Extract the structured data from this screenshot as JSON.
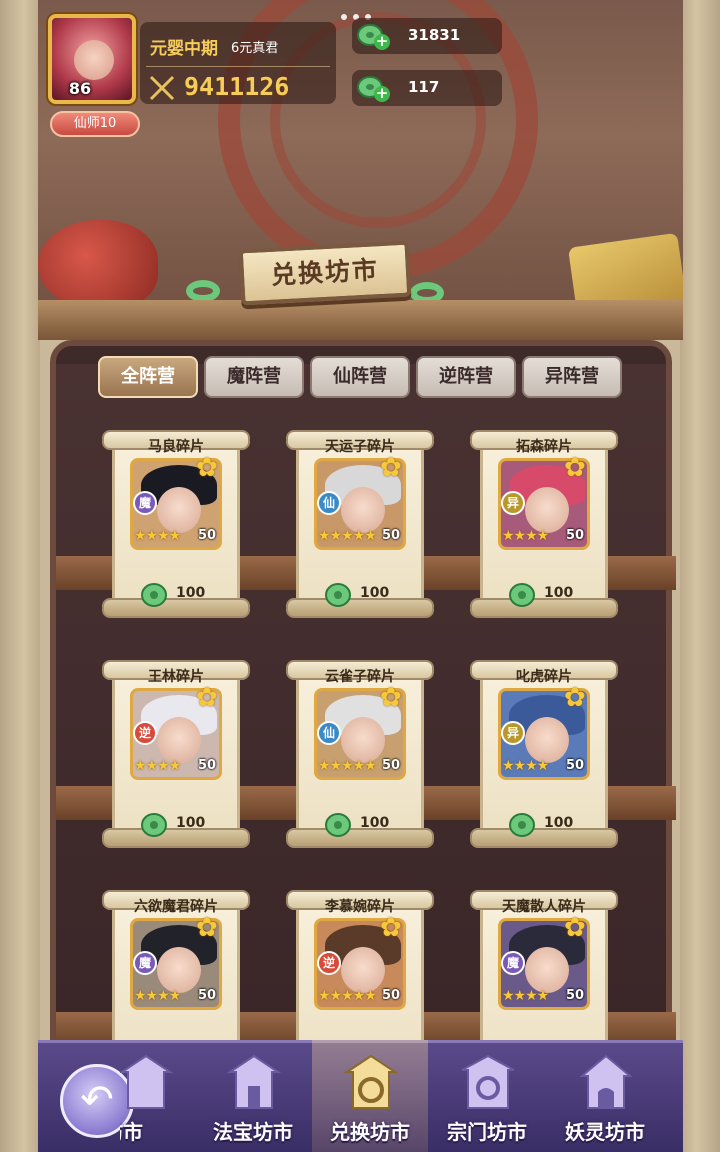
{
  "player": {
    "level": "86",
    "rank_badge": "仙师10",
    "realm": "元婴中期",
    "title": "6元真君",
    "power": "9411126"
  },
  "currency": [
    {
      "icon": "jade-coin-icon",
      "value": "31831"
    },
    {
      "icon": "jade-token-icon",
      "value": "117"
    }
  ],
  "sign_title": "兑换坊市",
  "tabs": [
    {
      "label": "全阵营",
      "active": true
    },
    {
      "label": "魔阵营",
      "active": false
    },
    {
      "label": "仙阵营",
      "active": false
    },
    {
      "label": "逆阵营",
      "active": false
    },
    {
      "label": "异阵营",
      "active": false
    }
  ],
  "cards": [
    {
      "name": "马良碎片",
      "faction": "魔",
      "faction_color": "#7a5ab8",
      "hair": "#1a1a22",
      "bg": "#cfa272",
      "stars": "★★★★",
      "star_count": "50",
      "price": "100"
    },
    {
      "name": "天运子碎片",
      "faction": "仙",
      "faction_color": "#3a8ac8",
      "hair": "#d8d8d8",
      "bg": "#c89868",
      "stars": "★★★★★",
      "star_count": "50",
      "price": "100"
    },
    {
      "name": "拓森碎片",
      "faction": "异",
      "faction_color": "#b8982a",
      "hair": "#d84a6a",
      "bg": "#a85a7a",
      "stars": "★★★★",
      "star_count": "50",
      "price": "100"
    },
    {
      "name": "王林碎片",
      "faction": "逆",
      "faction_color": "#d84a3a",
      "hair": "#e8e8ee",
      "bg": "#cdb8b0",
      "stars": "★★★★",
      "star_count": "50",
      "price": "100"
    },
    {
      "name": "云雀子碎片",
      "faction": "仙",
      "faction_color": "#3a8ac8",
      "hair": "#e0e0e0",
      "bg": "#c8a070",
      "stars": "★★★★★",
      "star_count": "50",
      "price": "100"
    },
    {
      "name": "叱虎碎片",
      "faction": "异",
      "faction_color": "#b8982a",
      "hair": "#3a5a9a",
      "bg": "#5a7ab8",
      "stars": "★★★★",
      "star_count": "50",
      "price": "100"
    },
    {
      "name": "六欲魔君碎片",
      "faction": "魔",
      "faction_color": "#7a5ab8",
      "hair": "#22222a",
      "bg": "#9a8a7a",
      "stars": "★★★★",
      "star_count": "50",
      "price": ""
    },
    {
      "name": "李慕婉碎片",
      "faction": "逆",
      "faction_color": "#d84a3a",
      "hair": "#5a3a28",
      "bg": "#c88a5a",
      "stars": "★★★★★",
      "star_count": "50",
      "price": ""
    },
    {
      "name": "天魔散人碎片",
      "faction": "魔",
      "faction_color": "#7a5ab8",
      "hair": "#2a2a3a",
      "bg": "#6a5a8a",
      "stars": "★★★★",
      "star_count": "50",
      "price": ""
    }
  ],
  "nav": [
    {
      "label": "坊市",
      "icon": "market-icon",
      "active": false
    },
    {
      "label": "法宝坊市",
      "icon": "treasure-market-icon",
      "active": false
    },
    {
      "label": "兑换坊市",
      "icon": "exchange-market-icon",
      "active": true
    },
    {
      "label": "宗门坊市",
      "icon": "sect-market-icon",
      "active": false
    },
    {
      "label": "妖灵坊市",
      "icon": "spirit-market-icon",
      "active": false
    }
  ]
}
